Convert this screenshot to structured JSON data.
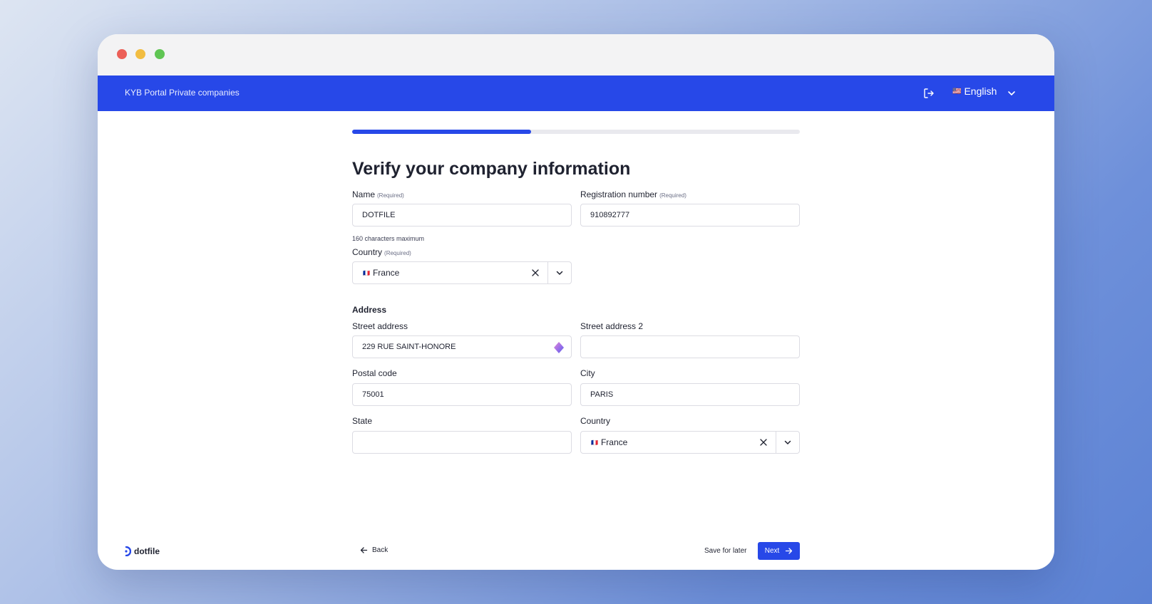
{
  "header": {
    "portal_title": "KYB Portal Private companies",
    "language": "English",
    "language_flag": "🇺🇸"
  },
  "progress": {
    "value": 0.4
  },
  "form": {
    "title": "Verify your company information",
    "required_tag": "(Required)",
    "name": {
      "label": "Name",
      "value": "DOTFILE",
      "hint": "160 characters maximum"
    },
    "registration": {
      "label": "Registration number",
      "value": "910892777"
    },
    "country": {
      "label": "Country",
      "value": "France",
      "flag": "🇫🇷"
    },
    "address": {
      "section_label": "Address",
      "street": {
        "label": "Street address",
        "value": "229 RUE SAINT-HONORE"
      },
      "street2": {
        "label": "Street address 2",
        "value": ""
      },
      "postal": {
        "label": "Postal code",
        "value": "75001"
      },
      "city": {
        "label": "City",
        "value": "PARIS"
      },
      "state": {
        "label": "State",
        "value": ""
      },
      "country": {
        "label": "Country",
        "value": "France",
        "flag": "🇫🇷"
      }
    }
  },
  "footer": {
    "brand": "dotfile",
    "back_label": "Back",
    "save_label": "Save for later",
    "next_label": "Next"
  },
  "colors": {
    "accent": "#2748e8"
  }
}
